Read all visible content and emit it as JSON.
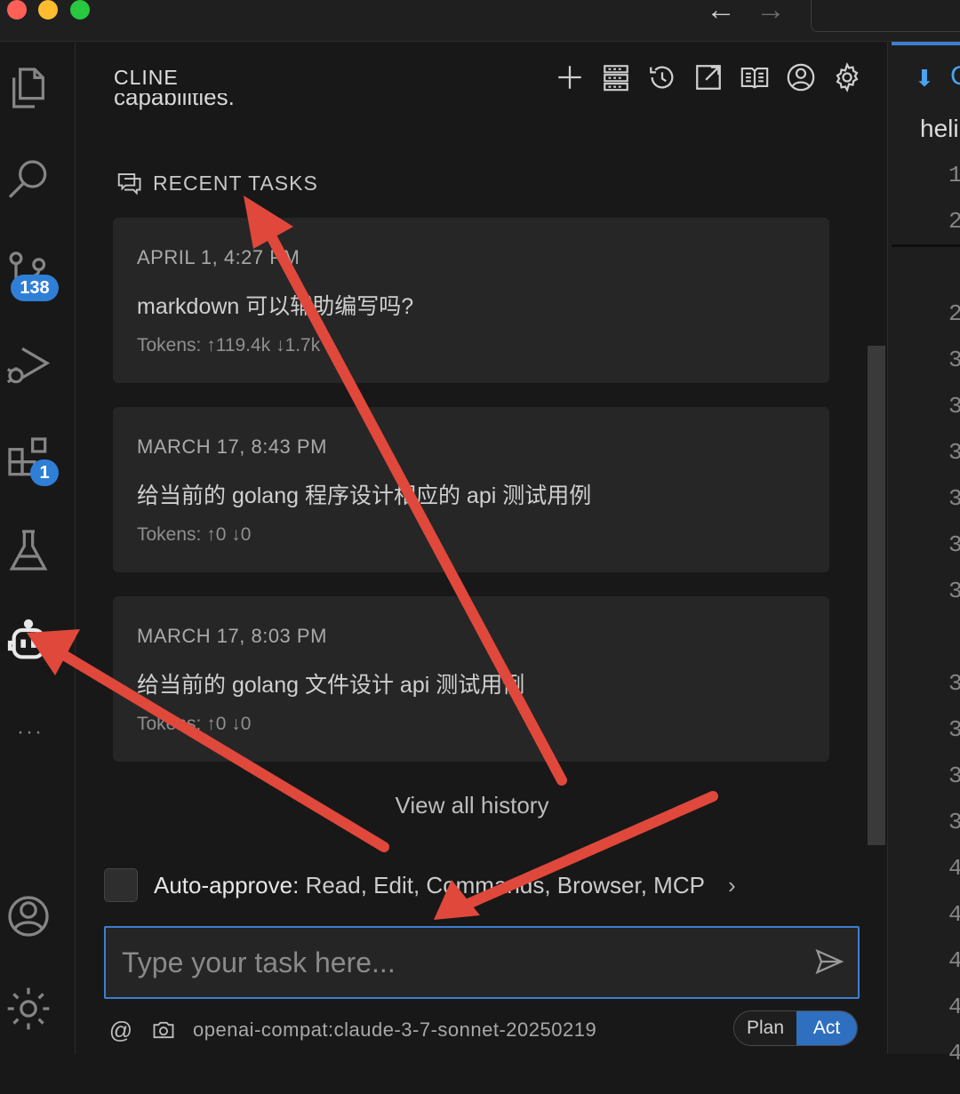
{
  "window": {
    "nav_back": "←",
    "nav_forward": "→"
  },
  "activity_bar": {
    "items": [
      {
        "name": "explorer-icon"
      },
      {
        "name": "search-icon"
      },
      {
        "name": "source-control-icon",
        "badge": "138"
      },
      {
        "name": "run-debug-icon"
      },
      {
        "name": "extensions-icon",
        "badge": "1"
      },
      {
        "name": "testing-icon"
      },
      {
        "name": "cline-robot-icon"
      },
      {
        "name": "more-icon",
        "glyph": "• • •"
      },
      {
        "name": "account-icon"
      },
      {
        "name": "manage-gear-icon"
      }
    ],
    "source_control_badge": "138",
    "extensions_badge": "1",
    "more_glyph": "···"
  },
  "panel": {
    "title": "CLINE",
    "cut_text": "capabilities.",
    "actions": [
      "plus-icon",
      "server-icon",
      "history-icon",
      "popout-icon",
      "docs-icon",
      "account-icon",
      "settings-icon"
    ],
    "recent_tasks_label": "RECENT TASKS",
    "tasks": [
      {
        "date": "APRIL 1, 4:27 PM",
        "text": "markdown 可以辅助编写吗?",
        "tokens": "Tokens: ↑119.4k ↓1.7k"
      },
      {
        "date": "MARCH 17, 8:43 PM",
        "text": "给当前的 golang 程序设计相应的 api 测试用例",
        "tokens": "Tokens: ↑0 ↓0"
      },
      {
        "date": "MARCH 17, 8:03 PM",
        "text": "给当前的 golang 文件设计 api 测试用例",
        "tokens": "Tokens: ↑0 ↓0"
      }
    ],
    "view_all_history": "View all history",
    "auto_approve": {
      "label": "Auto-approve:",
      "value": "Read, Edit, Commands, Browser, MCP",
      "chevron": "›"
    },
    "input": {
      "placeholder": "Type your task here..."
    },
    "bottom": {
      "at_symbol": "@",
      "model": "openai-compat:claude-3-7-sonnet-20250219",
      "plan_label": "Plan",
      "act_label": "Act"
    }
  },
  "editor": {
    "tab_label": "C",
    "file_label": "heli",
    "gutter_digits": [
      "1",
      "2",
      "",
      "2",
      "3",
      "3",
      "3",
      "3",
      "3",
      "3",
      "",
      "3",
      "3",
      "3",
      "3",
      "4",
      "4",
      "4",
      "4",
      "4"
    ]
  },
  "colors": {
    "accent": "#3d7fcf",
    "badge": "#2f7fd6",
    "annotation_arrow": "#e0483b",
    "panel_bg": "#181818",
    "card_bg": "#262626"
  }
}
